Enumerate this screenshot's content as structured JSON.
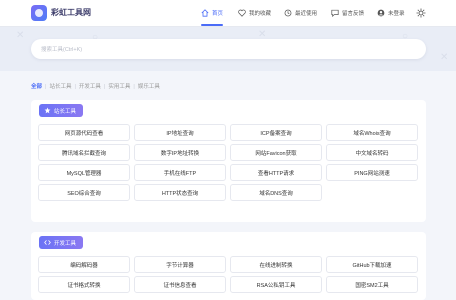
{
  "site": {
    "name": "彩虹工具网"
  },
  "nav": {
    "home": "首页",
    "favorites": "我的收藏",
    "recent": "最近使用",
    "feedback": "留言反馈",
    "login": "未登录"
  },
  "search": {
    "placeholder": "搜索工具(Ctrl+K)"
  },
  "breadcrumb": [
    "全部",
    "站长工具",
    "开发工具",
    "实用工具",
    "娱乐工具"
  ],
  "sections": [
    {
      "title": "站长工具",
      "icon": "star-icon",
      "tools": [
        "网页源代码查看",
        "IP地址查询",
        "ICP备案查询",
        "域名Whois查询",
        "腾讯域名拦截查询",
        "数字IP地址转换",
        "网站Favicon获取",
        "中文域名转码",
        "MySQL管理器",
        "手机在线FTP",
        "查看HTTP请求",
        "PING网站测速",
        "SEO综合查询",
        "HTTP状态查询",
        "域名DNS查询"
      ]
    },
    {
      "title": "开发工具",
      "icon": "code-icon",
      "tools": [
        "编码解码器",
        "字节计算器",
        "在线进制转换",
        "GitHub下载加速",
        "证书格式转换",
        "证书信息查看",
        "RSA公私钥工具",
        "国密SM2工具"
      ]
    }
  ],
  "colors": {
    "accent": "#4b6cf7",
    "badge": "#6b73f5",
    "background": "#f3f5fa"
  }
}
